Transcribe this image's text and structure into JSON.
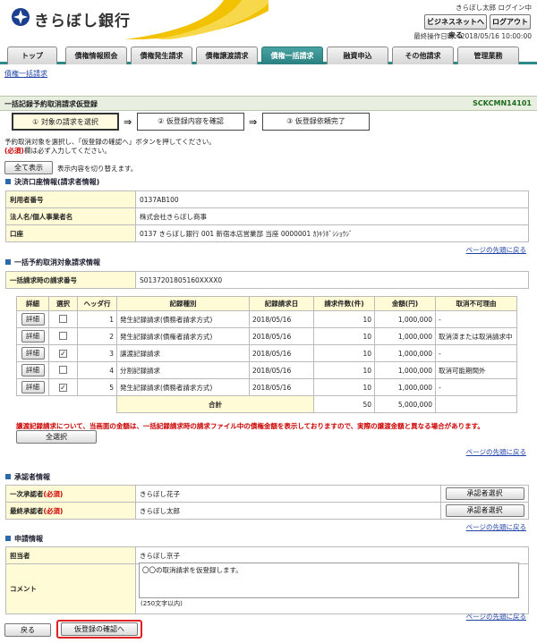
{
  "header": {
    "bank_name": "きらぼし銀行",
    "user_login": "きらぼし太郎 ログイン中",
    "biz_back": "ビジネスネットへ戻る",
    "logout": "ログアウト",
    "last_operation": "最終操作日時：2018/05/16 10:00:00"
  },
  "tabs": [
    "トップ",
    "債権情報照会",
    "債権発生請求",
    "債権譲渡請求",
    "債権一括請求",
    "融資申込",
    "その他請求",
    "管理業務"
  ],
  "subnav": "債権一括請求",
  "page": {
    "title": "一括記録予約取消請求仮登録",
    "screen_id": "SCKCMN14101"
  },
  "steps": [
    "① 対象の請求を選択",
    "② 仮登録内容を確認",
    "③ 仮登録依頼完了"
  ],
  "instructions": {
    "line1": "予約取消対象を選択し、「仮登録の確認へ」ボタンを押してください。",
    "line2_req": "(必須)",
    "line2_rest": "欄は必ず入力してください。"
  },
  "show_all": {
    "button": "全て表示",
    "text": "表示内容を切り替えます。"
  },
  "account_section": {
    "heading": "決済口座情報(請求者情報)",
    "rows": [
      {
        "label": "利用者番号",
        "value": "0137AB100"
      },
      {
        "label": "法人名/個人事業者名",
        "value": "株式会社きらぼし商事"
      },
      {
        "label": "口座",
        "value": "0137 きらぼし銀行 001 新宿本店営業部 当座 0000001 ｶ)ｷﾗﾎﾞｼｼｮｳｼﾞ"
      }
    ]
  },
  "page_top_link": "ページの先頭に戻る",
  "target_section": {
    "heading": "一括予約取消対象請求情報",
    "request_label": "一括請求時の請求番号",
    "request_value": "S0137201805160XXXX0"
  },
  "list": {
    "headers": [
      "詳細",
      "選択",
      "ヘッダ行",
      "記録種別",
      "記録請求日",
      "請求件数(件)",
      "金額(円)",
      "取消不可理由"
    ],
    "detail_label": "詳細",
    "rows": [
      {
        "checked": false,
        "no": "1",
        "type": "発生記録請求(債務者請求方式)",
        "date": "2018/05/16",
        "count": "10",
        "amount": "1,000,000",
        "reason": "-"
      },
      {
        "checked": false,
        "no": "2",
        "type": "発生記録請求(債権者請求方式)",
        "date": "2018/05/16",
        "count": "10",
        "amount": "1,000,000",
        "reason": "取消済または取消請求中"
      },
      {
        "checked": true,
        "no": "3",
        "type": "譲渡記録請求",
        "date": "2018/05/16",
        "count": "10",
        "amount": "1,000,000",
        "reason": "-"
      },
      {
        "checked": false,
        "no": "4",
        "type": "分割記録請求",
        "date": "2018/05/16",
        "count": "10",
        "amount": "1,000,000",
        "reason": "取消可能期間外"
      },
      {
        "checked": true,
        "no": "5",
        "type": "発生記録請求(債務者請求方式)",
        "date": "2018/05/16",
        "count": "10",
        "amount": "1,000,000",
        "reason": "-"
      }
    ],
    "total_label": "合計",
    "total_count": "50",
    "total_amount": "5,000,000"
  },
  "warning": "譲渡記録請求について、当画面の金額は、一括記録請求時の請求ファイル中の債権金額を表示しておりますので、実際の譲渡金額と異なる場合があります。",
  "select_all": "全選択",
  "approver_section": {
    "heading": "承認者情報",
    "rows": [
      {
        "label": "一次承認者",
        "req": "(必須)",
        "value": "きらぼし花子",
        "button": "承認者選択"
      },
      {
        "label": "最終承認者",
        "req": "(必須)",
        "value": "きらぼし太郎",
        "button": "承認者選択"
      }
    ]
  },
  "application_section": {
    "heading": "申請情報",
    "person_label": "担当者",
    "person_value": "きらぼし京子",
    "comment_label": "コメント",
    "comment_value": "〇〇の取消請求を仮登録します。",
    "comment_limit": "(250文字以内)"
  },
  "footer": {
    "back": "戻る",
    "confirm": "仮登録の確認へ"
  },
  "colors": {
    "teal": "#2a8a8a",
    "required_red": "#cc0000",
    "highlight_red": "#e02020",
    "header_yellow": "#fffbd6"
  }
}
